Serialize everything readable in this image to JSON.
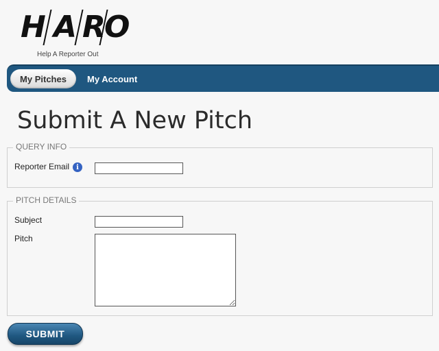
{
  "logo": {
    "letters": [
      "H",
      "A",
      "R",
      "O"
    ],
    "tagline": "Help A Reporter Out"
  },
  "nav": {
    "active_tab": "My Pitches",
    "tab_account": "My Account"
  },
  "page": {
    "title": "Submit A New Pitch"
  },
  "query_info": {
    "legend": "QUERY INFO",
    "reporter_email_label": "Reporter Email",
    "reporter_email_value": "",
    "info_icon": "info-icon"
  },
  "pitch_details": {
    "legend": "PITCH DETAILS",
    "subject_label": "Subject",
    "subject_value": "",
    "pitch_label": "Pitch",
    "pitch_value": ""
  },
  "actions": {
    "submit_label": "SUBMIT"
  },
  "colors": {
    "nav_bar": "#1f5780",
    "info_icon": "#3563c2",
    "background": "#f7f7f7"
  }
}
